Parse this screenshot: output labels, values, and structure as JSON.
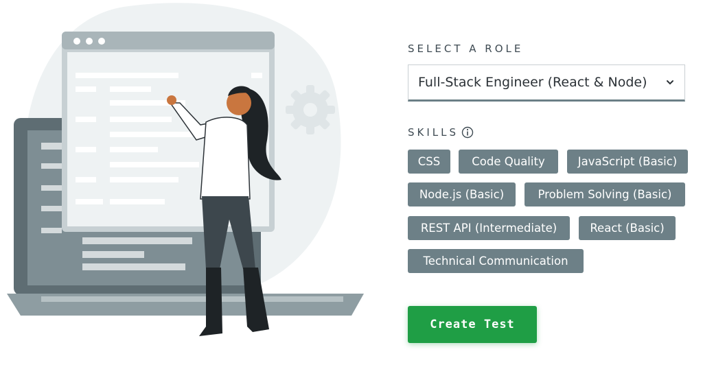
{
  "role_section": {
    "label": "SELECT A ROLE",
    "selected_role": "Full-Stack Engineer (React & Node)"
  },
  "skills_section": {
    "label": "SKILLS",
    "skills": [
      "CSS",
      "Code Quality",
      "JavaScript (Basic)",
      "Node.js (Basic)",
      "Problem Solving (Basic)",
      "REST API (Intermediate)",
      "React (Basic)",
      "Technical Communication"
    ]
  },
  "actions": {
    "create_label": "Create Test"
  },
  "colors": {
    "tag_bg": "#6d8087",
    "button_green": "#1f9e45",
    "text": "#3e4a52"
  }
}
